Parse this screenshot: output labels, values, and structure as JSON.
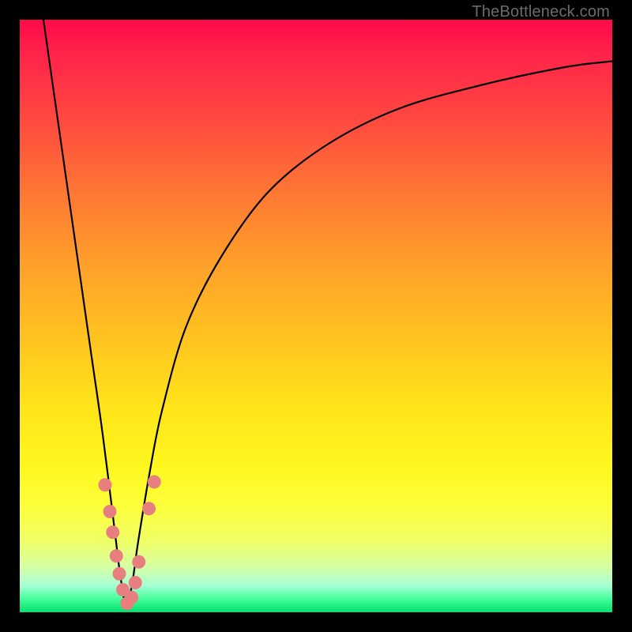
{
  "attribution": "TheBottleneck.com",
  "colors": {
    "frame": "#000000",
    "dot": "#e77f81",
    "curve": "#000000",
    "gradient_top": "#ff0a4a",
    "gradient_bottom": "#00e26b"
  },
  "chart_data": {
    "type": "line",
    "title": "",
    "xlabel": "",
    "ylabel": "",
    "xlim": [
      0,
      100
    ],
    "ylim": [
      0,
      100
    ],
    "grid": false,
    "legend": false,
    "curve_description": "V-shaped bottleneck curve: steep descent from top-left into minimum near x≈18, then logarithmic rise toward top-right",
    "series": [
      {
        "name": "bottleneck-curve",
        "x": [
          4,
          6,
          8,
          10,
          12,
          14,
          16,
          17,
          18,
          19,
          20,
          22,
          24,
          28,
          34,
          42,
          52,
          64,
          78,
          92,
          100
        ],
        "y": [
          100,
          86,
          72,
          58,
          44,
          30,
          14,
          6,
          1,
          5,
          12,
          24,
          34,
          48,
          60,
          71,
          79,
          85,
          89,
          92,
          93
        ]
      }
    ],
    "highlight_points": [
      {
        "x": 14.4,
        "y": 21.5
      },
      {
        "x": 15.2,
        "y": 17.0
      },
      {
        "x": 15.7,
        "y": 13.5
      },
      {
        "x": 16.3,
        "y": 9.5
      },
      {
        "x": 16.8,
        "y": 6.5
      },
      {
        "x": 17.4,
        "y": 3.8
      },
      {
        "x": 18.1,
        "y": 1.5
      },
      {
        "x": 18.9,
        "y": 2.5
      },
      {
        "x": 19.5,
        "y": 5.0
      },
      {
        "x": 20.1,
        "y": 8.5
      },
      {
        "x": 21.8,
        "y": 17.5
      },
      {
        "x": 22.7,
        "y": 22.0
      }
    ]
  }
}
